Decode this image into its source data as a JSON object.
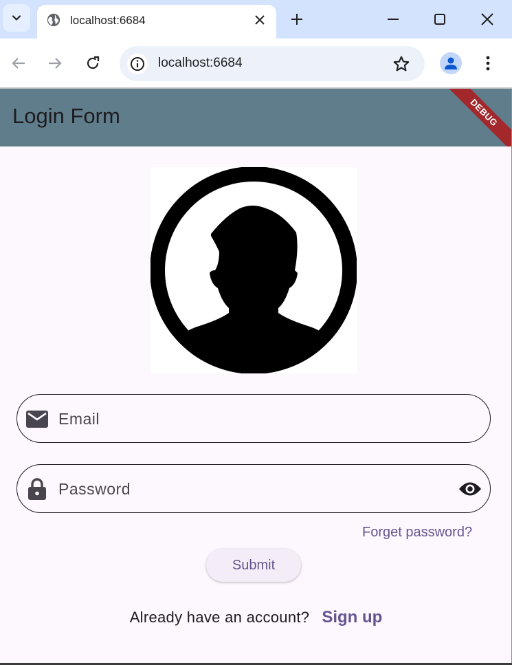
{
  "browser": {
    "tab_title": "localhost:6684",
    "url": "localhost:6684",
    "icons": [
      "chevron-down-icon",
      "globe-icon",
      "close-icon",
      "plus-icon",
      "minimize-icon",
      "maximize-icon",
      "back-icon",
      "forward-icon",
      "reload-icon",
      "info-icon",
      "star-icon",
      "profile-icon",
      "more-vert-icon"
    ]
  },
  "app": {
    "title": "Login Form",
    "debug_banner": "DEBUG",
    "appbar_color": "#607d8b",
    "accent_color": "#65558f"
  },
  "form": {
    "email_placeholder": "Email",
    "password_placeholder": "Password",
    "forgot_label": "Forget password?",
    "submit_label": "Submit",
    "signup_prompt": "Already have an account?",
    "signup_label": "Sign up"
  }
}
